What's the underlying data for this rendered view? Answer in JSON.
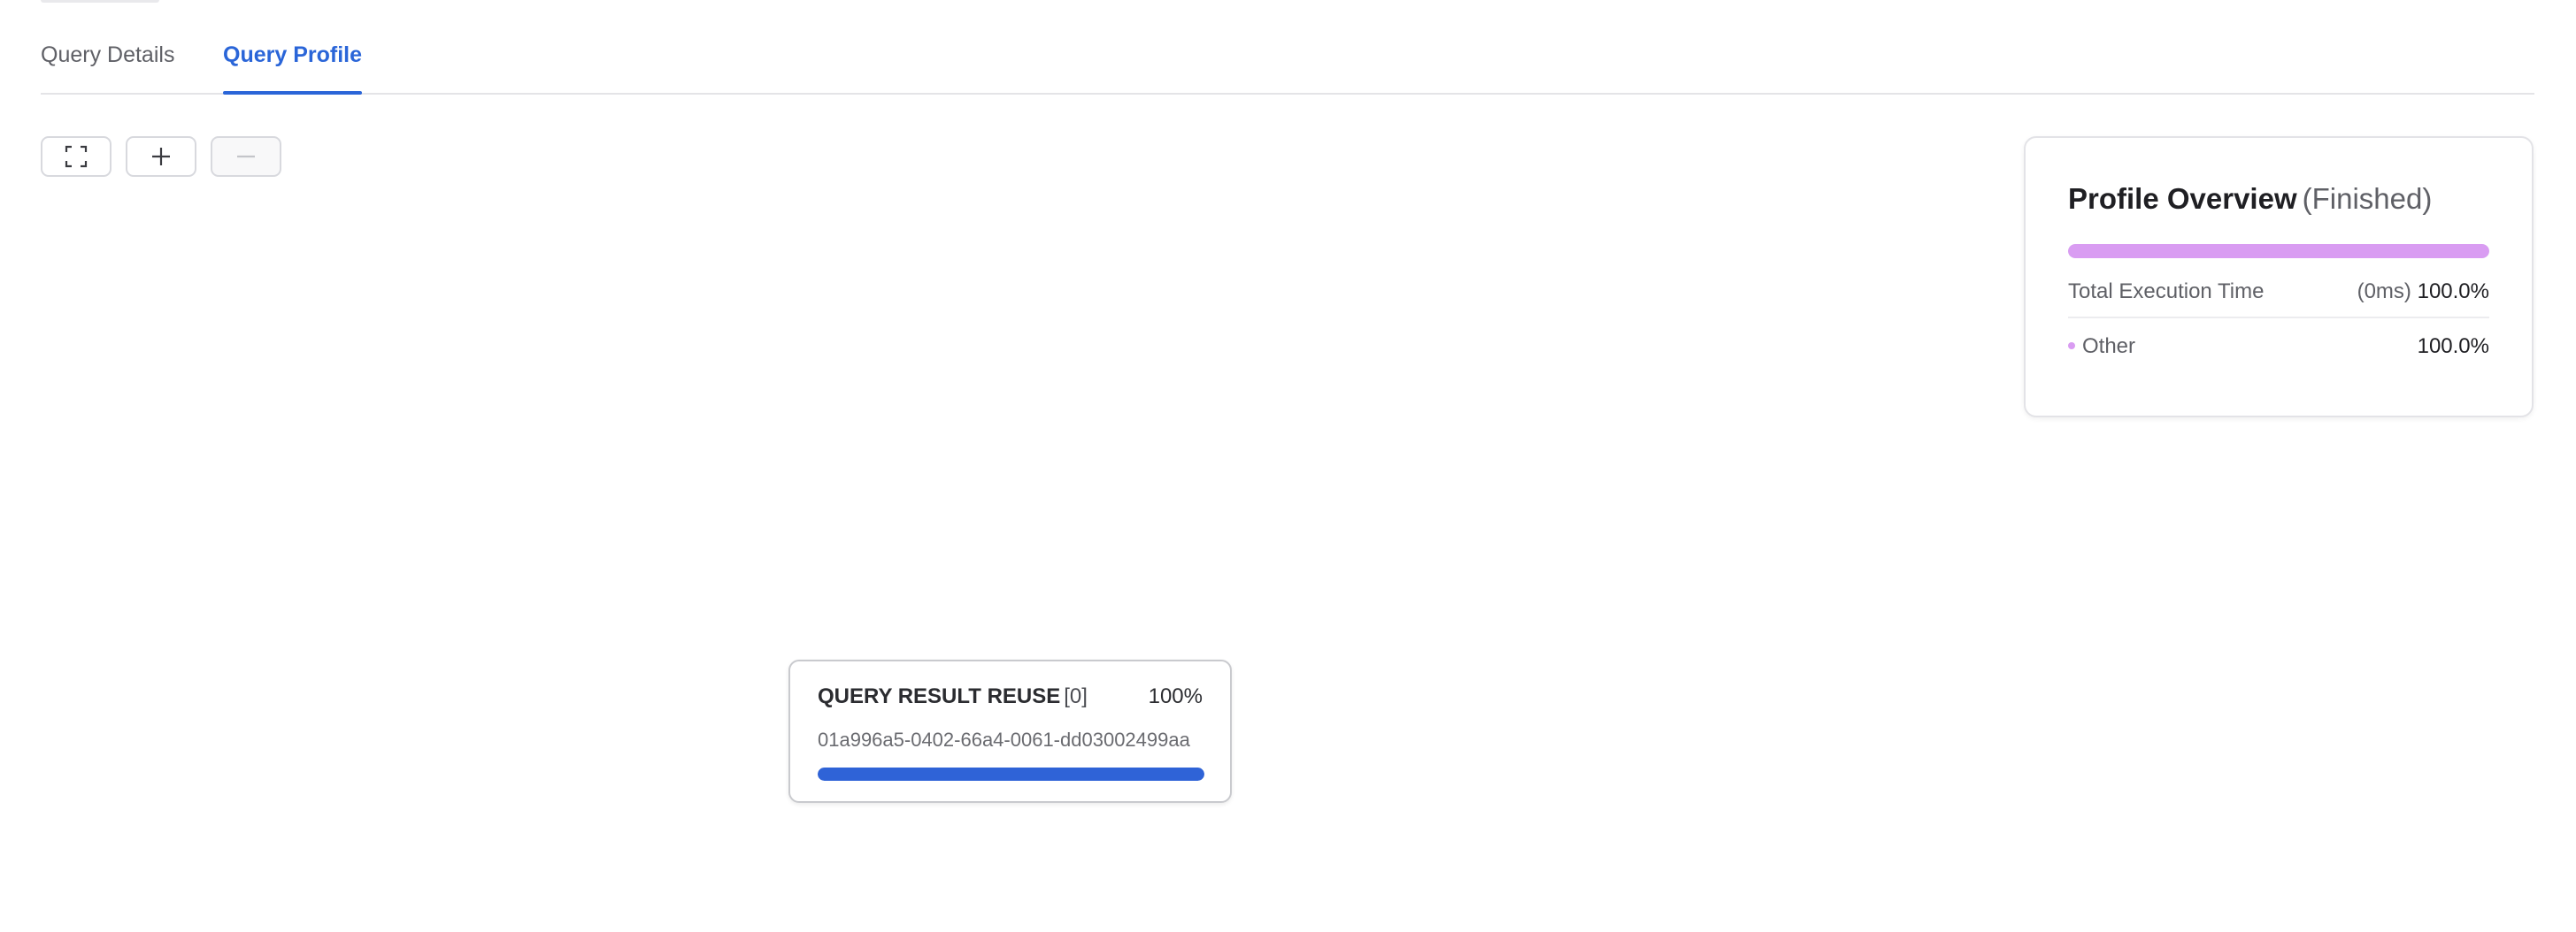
{
  "tabs": [
    {
      "label": "Query Details",
      "active": false
    },
    {
      "label": "Query Profile",
      "active": true
    }
  ],
  "toolbar": {
    "fit_icon": "fit-to-screen-icon",
    "zoom_in_icon": "plus-icon",
    "zoom_out_icon": "minus-icon",
    "zoom_out_enabled": false
  },
  "overview": {
    "title": "Profile Overview",
    "status": "(Finished)",
    "bar_fraction": 1.0,
    "bar_color": "#d99cf2",
    "total_label": "Total Execution Time",
    "total_time": "(0ms)",
    "total_pct": "100.0%",
    "rows": [
      {
        "label": "Other",
        "pct": "100.0%",
        "color": "#d99cf2"
      }
    ]
  },
  "node": {
    "operator": "QUERY RESULT REUSE",
    "index": "[0]",
    "pct": "100%",
    "id": "01a996a5-0402-66a4-0061-dd03002499aa",
    "bar_fraction": 1.0,
    "bar_color": "#2f63d7"
  },
  "colors": {
    "accent": "#2a65d8",
    "border": "#e4e4e7"
  }
}
